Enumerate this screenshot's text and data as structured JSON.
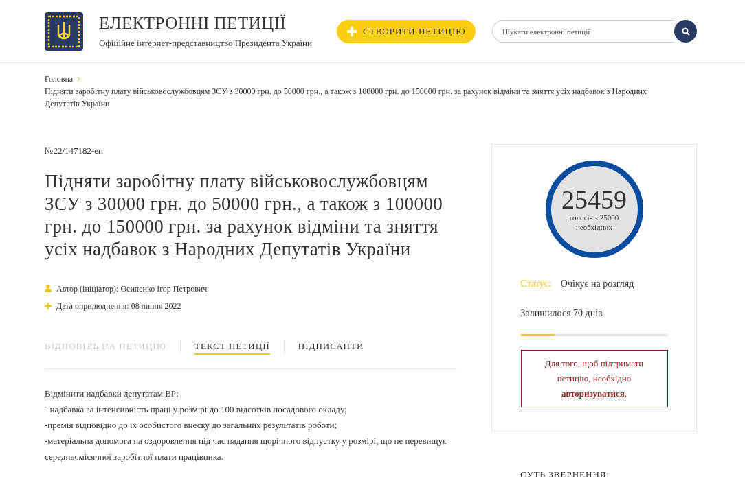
{
  "header": {
    "title": "ЕЛЕКТРОННІ ПЕТИЦІЇ",
    "subtitle": "Офіційне інтернет-представництво Президента України",
    "create_button": "СТВОРИТИ ПЕТИЦІЮ",
    "search": {
      "placeholder": "Шукати електронні петиції"
    }
  },
  "breadcrumbs": [
    "Головна",
    "Підняти заробітну плату військовослужбовцям ЗСУ з 30000 грн. до 50000 грн., а також з 100000 грн. до 150000 грн. за рахунок відміни та зняття усіх надбавок з Народних Депутатів України"
  ],
  "petition": {
    "number": "№22/147182-еп",
    "title": "Підняти заробітну плату військовослужбовцям ЗСУ з 30000 грн. до 50000 грн., а також з 100000 грн. до 150000 грн. за рахунок відміни та зняття усіх надбавок з Народних Депутатів України",
    "meta": [
      {
        "kind": "author",
        "text": "Автор (ініціатор): Осипенко Ігор Петрович"
      },
      {
        "kind": "date",
        "text": "Дата оприлюднення: 08 липня 2022"
      }
    ],
    "tabs": [
      {
        "label": "ВІДПОВІДЬ НА ПЕТИЦІЮ",
        "selected": false,
        "disabled": true
      },
      {
        "label": "ТЕКСТ ПЕТИЦІЇ",
        "selected": true,
        "disabled": false
      },
      {
        "label": "ПІДПИСАНТИ",
        "selected": false,
        "disabled": false
      }
    ],
    "body": [
      "Відмінити надбавки депутатам ВР:",
      "- надбавка за інтенсивність праці у розмірі до 100 відсотків посадового окладу;",
      "-премія відповідно до їх особистого внеску до загальних результатів роботи;",
      "-матеріальна допомога на оздоровлення під час надання щорічного відпустку у розмірі, що не перевищує середньомісячної заробітної плати працівника."
    ]
  },
  "sidebar": {
    "votes": "25459",
    "votes_caption": "голосів з 25000 необхідних",
    "status_label": "Статус:",
    "status": "Очікує на розгляд",
    "remaining": "Залишилося 70 днів",
    "progress": {
      "level": 0.23
    },
    "auth": {
      "text_before": "Для того, щоб підтримати петицію, необхідно",
      "link": "авторизуватися",
      "text_after": "."
    },
    "section_heading": "СУТЬ ЗВЕРНЕННЯ:"
  }
}
